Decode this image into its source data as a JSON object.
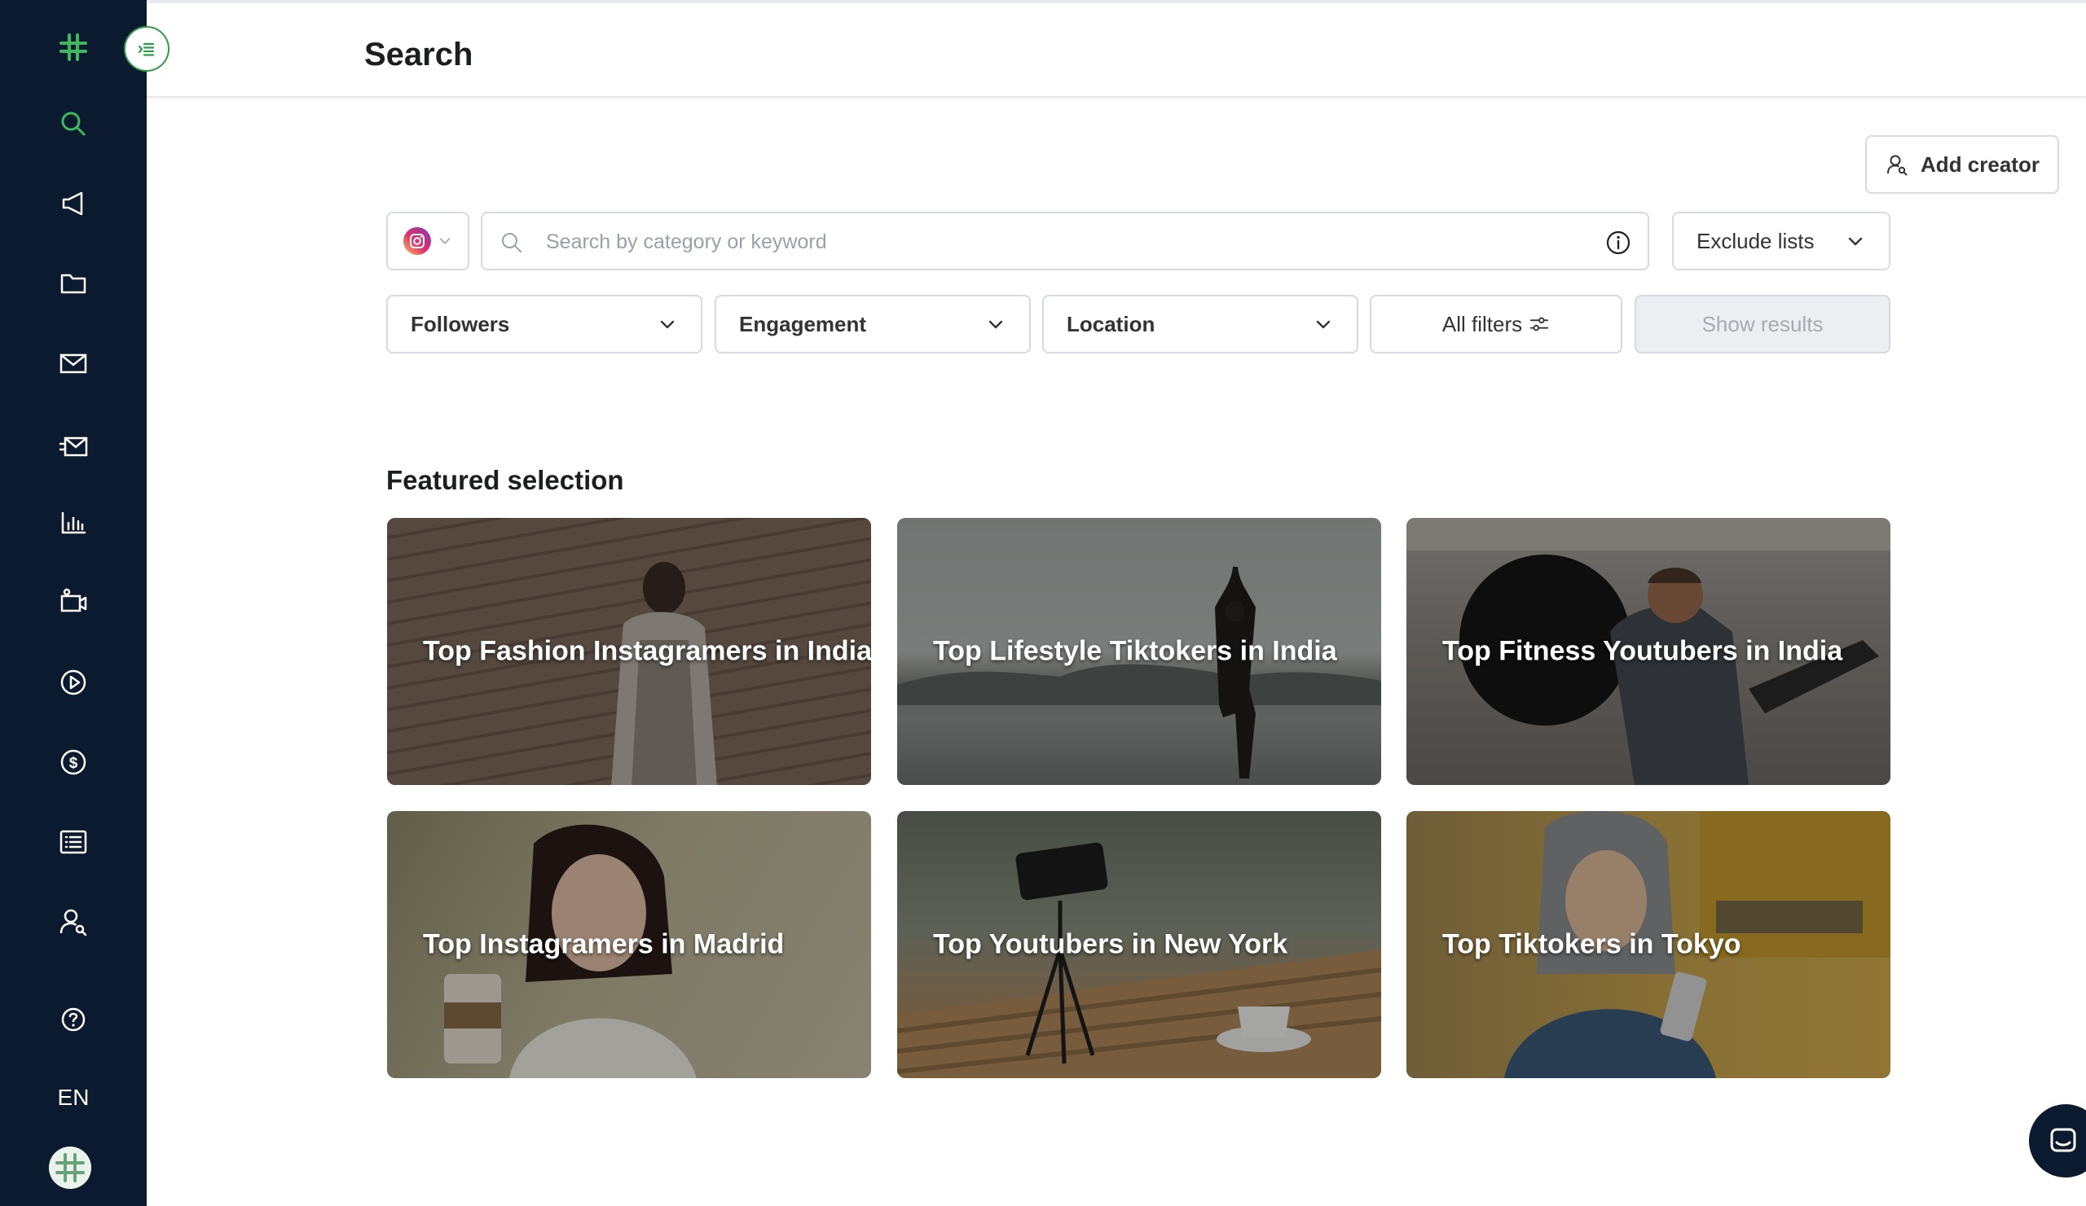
{
  "header": {
    "title": "Search"
  },
  "sidebar": {
    "language": "EN"
  },
  "actions": {
    "add_creator": "Add creator"
  },
  "search": {
    "placeholder": "Search by category or keyword",
    "platform_icon": "instagram-icon",
    "exclude_lists": "Exclude lists"
  },
  "filters": {
    "followers": "Followers",
    "engagement": "Engagement",
    "location": "Location",
    "all_filters": "All filters",
    "show_results": "Show results"
  },
  "featured": {
    "title": "Featured selection",
    "cards": [
      {
        "label": "Top Fashion Instagramers in India"
      },
      {
        "label": "Top Lifestyle Tiktokers in India"
      },
      {
        "label": "Top Fitness Youtubers in India"
      },
      {
        "label": "Top Instagramers in Madrid"
      },
      {
        "label": "Top Youtubers in New York"
      },
      {
        "label": "Top Tiktokers in Tokyo"
      }
    ]
  },
  "colors": {
    "sidebar_bg": "#0b1a2e",
    "brand_green": "#3dba5c",
    "border": "#d7dadf"
  }
}
